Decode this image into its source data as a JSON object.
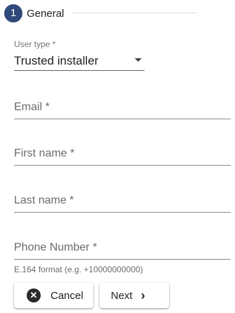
{
  "stepper": {
    "number": "1",
    "title": "General"
  },
  "user_type": {
    "label": "User type *",
    "value": "Trusted installer"
  },
  "fields": {
    "email": "Email *",
    "first_name": "First name *",
    "last_name": "Last name *",
    "phone": "Phone Number *",
    "phone_helper": "E.164 format (e.g. +10000000000)"
  },
  "buttons": {
    "cancel": "Cancel",
    "next": "Next"
  },
  "icons": {
    "cancel": "close-circle-icon",
    "next": "chevron-right-icon"
  },
  "colors": {
    "step_circle": "#2d4a7a"
  }
}
